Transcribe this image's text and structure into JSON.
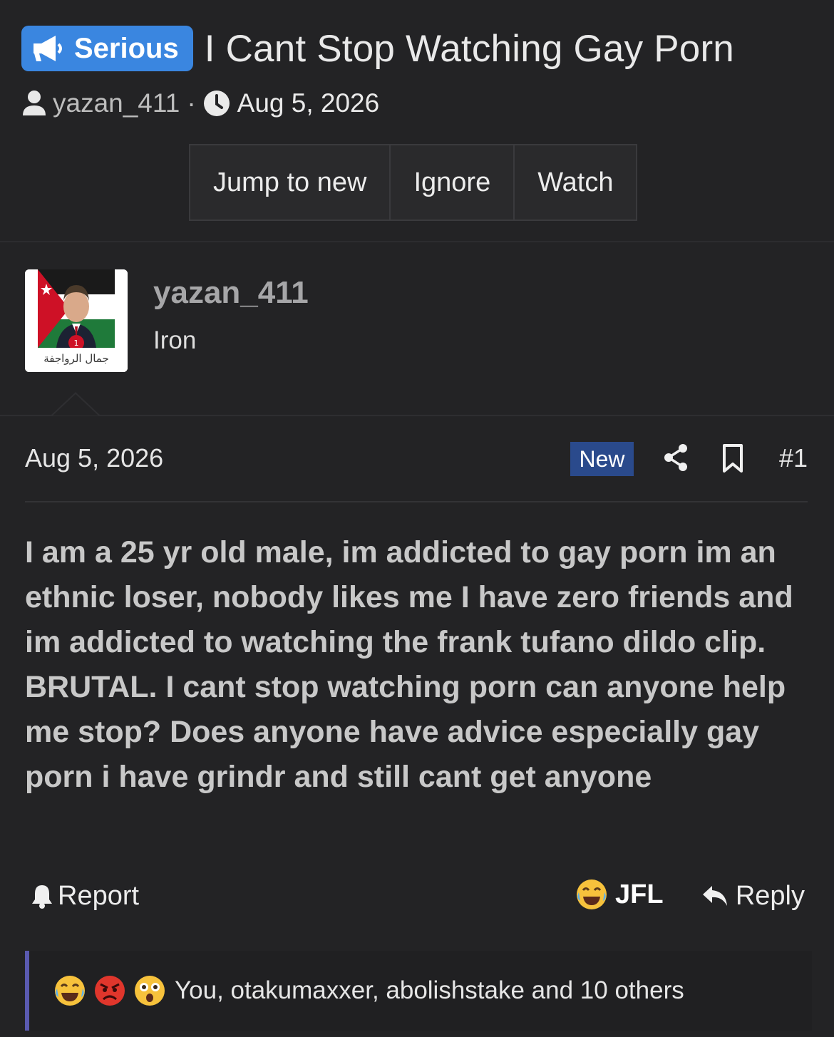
{
  "thread": {
    "prefix_label": "Serious",
    "title": "I Cant Stop Watching Gay Porn",
    "author": "yazan_411",
    "meta_separator": "·",
    "date": "Aug 5, 2026"
  },
  "thread_buttons": {
    "jump_to_new": "Jump to new",
    "ignore": "Ignore",
    "watch": "Watch"
  },
  "user": {
    "name": "yazan_411",
    "title": "Iron",
    "avatar_caption": "جمال الرواجفة",
    "avatar_number": "1"
  },
  "post": {
    "date": "Aug 5, 2026",
    "new_badge": "New",
    "number": "#1",
    "body": "I am a 25 yr old male, im addicted to gay porn im an ethnic loser, nobody likes me I have zero friends and im addicted to watching the frank tufano dildo clip. BRUTAL. I cant stop watching porn can anyone help me stop? Does anyone have advice especially gay porn i have grindr and still cant get anyone"
  },
  "post_actions": {
    "report": "Report",
    "reaction_label": "JFL",
    "reply": "Reply"
  },
  "reactions": {
    "icons": [
      "crying-laughing-icon",
      "angry-face-icon",
      "shocked-face-icon"
    ],
    "summary": "You, otakumaxxer, abolishstake and 10 others"
  },
  "colors": {
    "background": "#232325",
    "prefix_blue": "#3a86e0",
    "new_badge": "#2a4a8c",
    "reaction_bar_accent": "#5a5ab0"
  }
}
